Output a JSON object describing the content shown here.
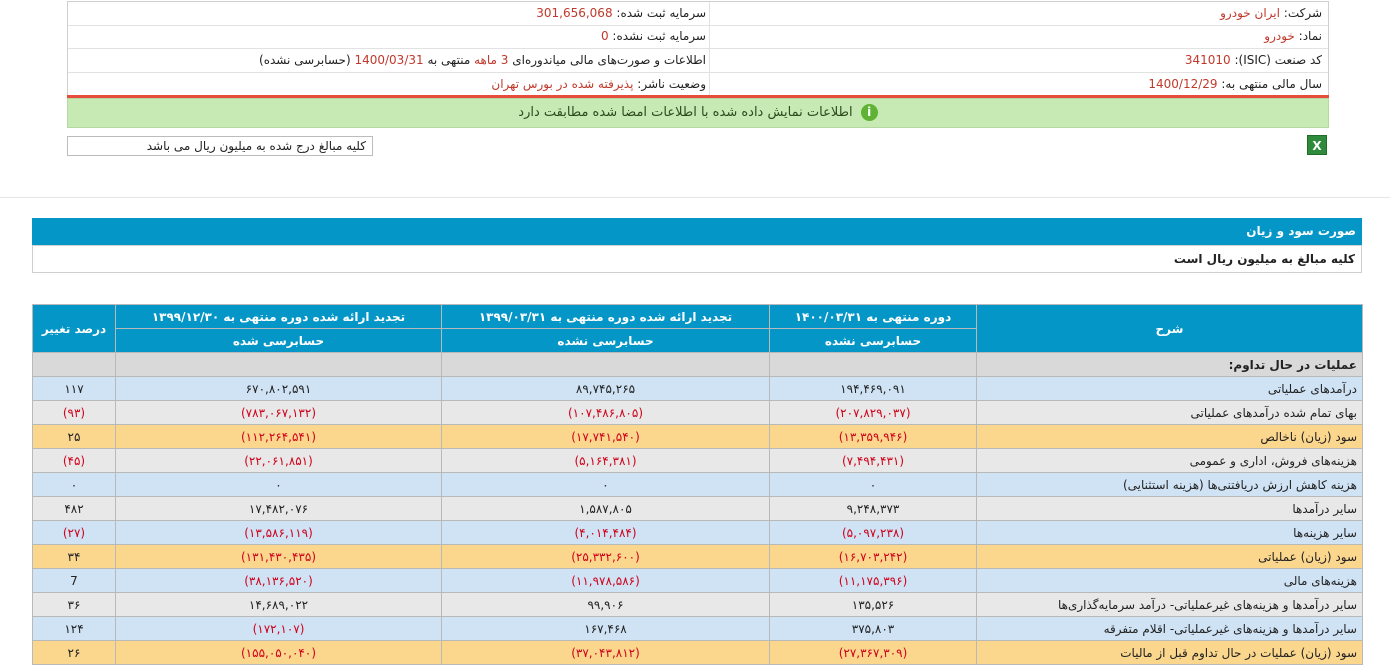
{
  "info": {
    "company_label": "شرکت:",
    "company_value": "ایران خودرو",
    "registered_capital_label": "سرمایه ثبت شده:",
    "registered_capital_value": "301,656,068",
    "symbol_label": "نماد:",
    "symbol_value": "خودرو",
    "unregistered_capital_label": "سرمایه ثبت نشده:",
    "unregistered_capital_value": "0",
    "isic_label": "کد صنعت (ISIC):",
    "isic_value": "341010",
    "report_text_1": "اطلاعات و صورت‌های مالی میاندوره‌ای",
    "report_period": "3 ماهه",
    "report_text_2": "منتهی به",
    "report_date": "1400/03/31",
    "report_text_3": "(حسابرسی نشده)",
    "fiscal_year_label": "سال مالی منتهی به:",
    "fiscal_year_value": "1400/12/29",
    "publisher_status_label": "وضعیت ناشر:",
    "publisher_status_value": "پذیرفته شده در بورس تهران"
  },
  "banner": {
    "text": "اطلاعات نمایش داده شده با اطلاعات امضا شده مطابقت دارد",
    "icon": "info-icon"
  },
  "note": "کلیه مبالغ درج شده به میلیون ریال می باشد",
  "excel_icon": "excel-icon",
  "section": {
    "title": "صورت سود و زیان",
    "subtitle": "کلیه مبالغ به میلیون ریال است"
  },
  "table": {
    "headers": {
      "desc": "شرح",
      "period_current": "دوره منتهی به ۱۴۰۰/۰۳/۳۱",
      "period_restated_q": "تجدید ارائه شده دوره منتهی به ۱۳۹۹/۰۳/۳۱",
      "period_restated_y": "تجدید ارائه شده دوره منتهی به ۱۳۹۹/۱۲/۳۰",
      "change_pct": "درصد تغییر"
    },
    "subheaders": {
      "current": "حسابرسی نشده",
      "restated_q": "حسابرسی نشده",
      "restated_y": "حسابرسی شده"
    },
    "category": "عملیات در حال تداوم:",
    "rows": [
      {
        "style": "blue",
        "desc": "درآمدهای عملیاتی",
        "cur": "۱۹۴,۴۶۹,۰۹۱",
        "rq": "۸۹,۷۴۵,۲۶۵",
        "ry": "۶۷۰,۸۰۲,۵۹۱",
        "pct": "۱۱۷",
        "neg": false,
        "pneg": false
      },
      {
        "style": "gray",
        "desc": "بهای تمام شده درآمدهای عملیاتی",
        "cur": "(۲۰۷,۸۲۹,۰۳۷)",
        "rq": "(۱۰۷,۴۸۶,۸۰۵)",
        "ry": "(۷۸۳,۰۶۷,۱۳۲)",
        "pct": "(۹۳)",
        "neg": true,
        "pneg": true
      },
      {
        "style": "gold",
        "desc": "سود (زیان) ناخالص",
        "cur": "(۱۳,۳۵۹,۹۴۶)",
        "rq": "(۱۷,۷۴۱,۵۴۰)",
        "ry": "(۱۱۲,۲۶۴,۵۴۱)",
        "pct": "۲۵",
        "neg": true,
        "pneg": false
      },
      {
        "style": "gray",
        "desc": "هزینه‌های فروش، اداری و عمومی",
        "cur": "(۷,۴۹۴,۴۳۱)",
        "rq": "(۵,۱۶۴,۳۸۱)",
        "ry": "(۲۲,۰۶۱,۸۵۱)",
        "pct": "(۴۵)",
        "neg": true,
        "pneg": true
      },
      {
        "style": "blue",
        "desc": "هزینه کاهش ارزش دریافتنی‌ها (هزینه استثنایی)",
        "cur": "۰",
        "rq": "۰",
        "ry": "۰",
        "pct": "۰",
        "neg": false,
        "pneg": false
      },
      {
        "style": "gray",
        "desc": "سایر درآمدها",
        "cur": "۹,۲۴۸,۳۷۳",
        "rq": "۱,۵۸۷,۸۰۵",
        "ry": "۱۷,۴۸۲,۰۷۶",
        "pct": "۴۸۲",
        "neg": false,
        "pneg": false
      },
      {
        "style": "blue",
        "desc": "سایر هزینه‌ها",
        "cur": "(۵,۰۹۷,۲۳۸)",
        "rq": "(۴,۰۱۴,۴۸۴)",
        "ry": "(۱۳,۵۸۶,۱۱۹)",
        "pct": "(۲۷)",
        "neg": true,
        "pneg": true
      },
      {
        "style": "gold",
        "desc": "سود (زیان) عملیاتی",
        "cur": "(۱۶,۷۰۳,۲۴۲)",
        "rq": "(۲۵,۳۳۲,۶۰۰)",
        "ry": "(۱۳۱,۴۳۰,۴۳۵)",
        "pct": "۳۴",
        "neg": true,
        "pneg": false
      },
      {
        "style": "blue",
        "desc": "هزینه‌های مالی",
        "cur": "(۱۱,۱۷۵,۳۹۶)",
        "rq": "(۱۱,۹۷۸,۵۸۶)",
        "ry": "(۳۸,۱۳۶,۵۲۰)",
        "pct": "7",
        "neg": true,
        "pneg": false
      },
      {
        "style": "gray",
        "desc": "سایر درآمدها و هزینه‌های غیرعملیاتی- درآمد سرمایه‌گذاری‌ها",
        "cur": "۱۳۵,۵۲۶",
        "rq": "۹۹,۹۰۶",
        "ry": "۱۴,۶۸۹,۰۲۲",
        "pct": "۳۶",
        "neg": false,
        "pneg": false
      },
      {
        "style": "blue",
        "desc": "سایر درآمدها و هزینه‌های غیرعملیاتی- اقلام متفرقه",
        "cur": "۳۷۵,۸۰۳",
        "rq": "۱۶۷,۴۶۸",
        "ry": "(۱۷۲,۱۰۷)",
        "pct": "۱۲۴",
        "neg": false,
        "pneg": false,
        "ryneg": true
      },
      {
        "style": "gold",
        "desc": "سود (زیان) عملیات در حال تداوم قبل از مالیات",
        "cur": "(۲۷,۳۶۷,۳۰۹)",
        "rq": "(۳۷,۰۴۳,۸۱۲)",
        "ry": "(۱۵۵,۰۵۰,۰۴۰)",
        "pct": "۲۶",
        "neg": true,
        "pneg": false
      }
    ]
  }
}
